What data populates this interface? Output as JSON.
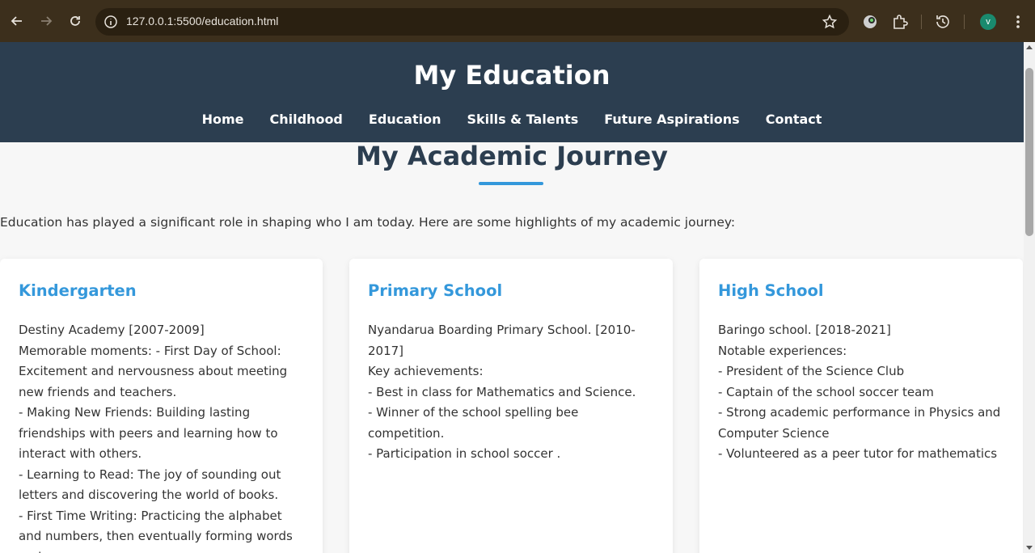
{
  "browser": {
    "url": "127.0.0.1:5500/education.html",
    "profile_initial": "v"
  },
  "site": {
    "title": "My Education",
    "nav": [
      "Home",
      "Childhood",
      "Education",
      "Skills & Talents",
      "Future Aspirations",
      "Contact"
    ]
  },
  "main": {
    "heading": "My Academic Journey",
    "intro": "Education has played a significant role in shaping who I am today. Here are some highlights of my academic journey:",
    "cards": [
      {
        "title": "Kindergarten",
        "lines": [
          "Destiny Academy [2007-2009]",
          "Memorable moments: - First Day of School: Excitement and nervousness about meeting new friends and teachers.",
          "- Making New Friends: Building lasting friendships with peers and learning how to interact with others.",
          "- Learning to Read: The joy of sounding out letters and discovering the world of books.",
          "- First Time Writing: Practicing the alphabet and numbers, then eventually forming words and"
        ]
      },
      {
        "title": "Primary School",
        "lines": [
          "Nyandarua Boarding Primary School. [2010-2017]",
          "Key achievements:",
          "- Best in class for Mathematics and Science.",
          "- Winner of the school spelling bee competition.",
          "- Participation in school soccer ."
        ]
      },
      {
        "title": "High School",
        "lines": [
          "Baringo school. [2018-2021]",
          "Notable experiences:",
          "- President of the Science Club",
          "- Captain of the school soccer team",
          "- Strong academic performance in Physics and Computer Science",
          "- Volunteered as a peer tutor for mathematics"
        ]
      }
    ]
  },
  "colors": {
    "header_bg": "#2c3e50",
    "accent": "#3498db",
    "chrome_bg": "#3c2f1c"
  }
}
